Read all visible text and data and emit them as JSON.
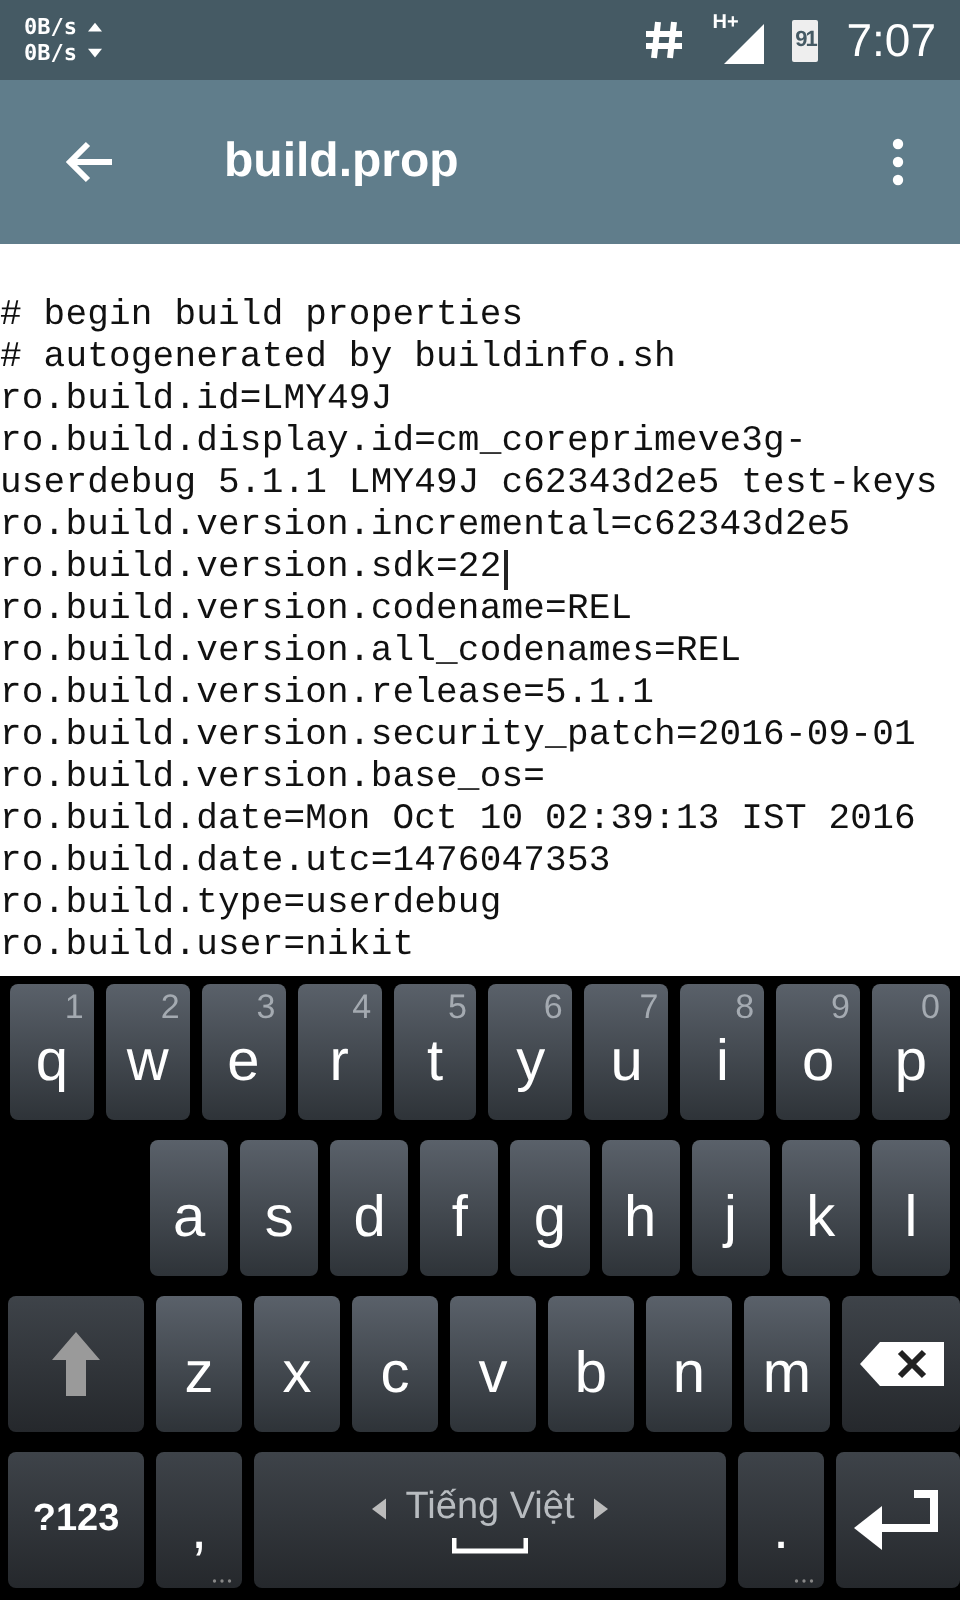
{
  "status_bar": {
    "net_up": "0B/s",
    "net_down": "0B/s",
    "network_type": "H+",
    "battery": "91",
    "time": "7:07"
  },
  "app_bar": {
    "title": "build.prop"
  },
  "editor": {
    "lines": [
      {
        "text": "# begin build properties",
        "cursor": false
      },
      {
        "text": "# autogenerated by buildinfo.sh",
        "cursor": false
      },
      {
        "text": "ro.build.id=LMY49J",
        "cursor": false
      },
      {
        "text": "ro.build.display.id=cm_coreprimeve3g-",
        "cursor": false
      },
      {
        "text": "userdebug 5.1.1 LMY49J c62343d2e5 test-keys",
        "cursor": false
      },
      {
        "text": "ro.build.version.incremental=c62343d2e5",
        "cursor": false
      },
      {
        "text": "ro.build.version.sdk=22",
        "cursor": true
      },
      {
        "text": "ro.build.version.codename=REL",
        "cursor": false
      },
      {
        "text": "ro.build.version.all_codenames=REL",
        "cursor": false
      },
      {
        "text": "ro.build.version.release=5.1.1",
        "cursor": false
      },
      {
        "text": "ro.build.version.security_patch=2016-09-01",
        "cursor": false
      },
      {
        "text": "ro.build.version.base_os=",
        "cursor": false
      },
      {
        "text": "ro.build.date=Mon Oct 10 02:39:13 IST 2016",
        "cursor": false
      },
      {
        "text": "ro.build.date.utc=1476047353",
        "cursor": false
      },
      {
        "text": "ro.build.type=userdebug",
        "cursor": false
      },
      {
        "text": "ro.build.user=nikit",
        "cursor": false
      }
    ]
  },
  "keyboard": {
    "rows": [
      {
        "keys": [
          {
            "kind": "letter",
            "label": "q",
            "hint": "1"
          },
          {
            "kind": "letter",
            "label": "w",
            "hint": "2"
          },
          {
            "kind": "letter",
            "label": "e",
            "hint": "3"
          },
          {
            "kind": "letter",
            "label": "r",
            "hint": "4"
          },
          {
            "kind": "letter",
            "label": "t",
            "hint": "5"
          },
          {
            "kind": "letter",
            "label": "y",
            "hint": "6"
          },
          {
            "kind": "letter",
            "label": "u",
            "hint": "7"
          },
          {
            "kind": "letter",
            "label": "i",
            "hint": "8"
          },
          {
            "kind": "letter",
            "label": "o",
            "hint": "9"
          },
          {
            "kind": "letter",
            "label": "p",
            "hint": "0"
          }
        ]
      },
      {
        "keys": [
          {
            "kind": "letter",
            "label": "a"
          },
          {
            "kind": "letter",
            "label": "s"
          },
          {
            "kind": "letter",
            "label": "d"
          },
          {
            "kind": "letter",
            "label": "f"
          },
          {
            "kind": "letter",
            "label": "g"
          },
          {
            "kind": "letter",
            "label": "h"
          },
          {
            "kind": "letter",
            "label": "j"
          },
          {
            "kind": "letter",
            "label": "k"
          },
          {
            "kind": "letter",
            "label": "l"
          }
        ]
      },
      {
        "keys": [
          {
            "kind": "shift"
          },
          {
            "kind": "letter",
            "label": "z"
          },
          {
            "kind": "letter",
            "label": "x"
          },
          {
            "kind": "letter",
            "label": "c"
          },
          {
            "kind": "letter",
            "label": "v"
          },
          {
            "kind": "letter",
            "label": "b"
          },
          {
            "kind": "letter",
            "label": "n"
          },
          {
            "kind": "letter",
            "label": "m"
          },
          {
            "kind": "backspace"
          }
        ]
      },
      {
        "keys": [
          {
            "kind": "symbols",
            "label": "?123"
          },
          {
            "kind": "punct",
            "label": ","
          },
          {
            "kind": "space",
            "label": "Tiếng Việt"
          },
          {
            "kind": "punct",
            "label": "."
          },
          {
            "kind": "enter"
          }
        ]
      }
    ]
  }
}
